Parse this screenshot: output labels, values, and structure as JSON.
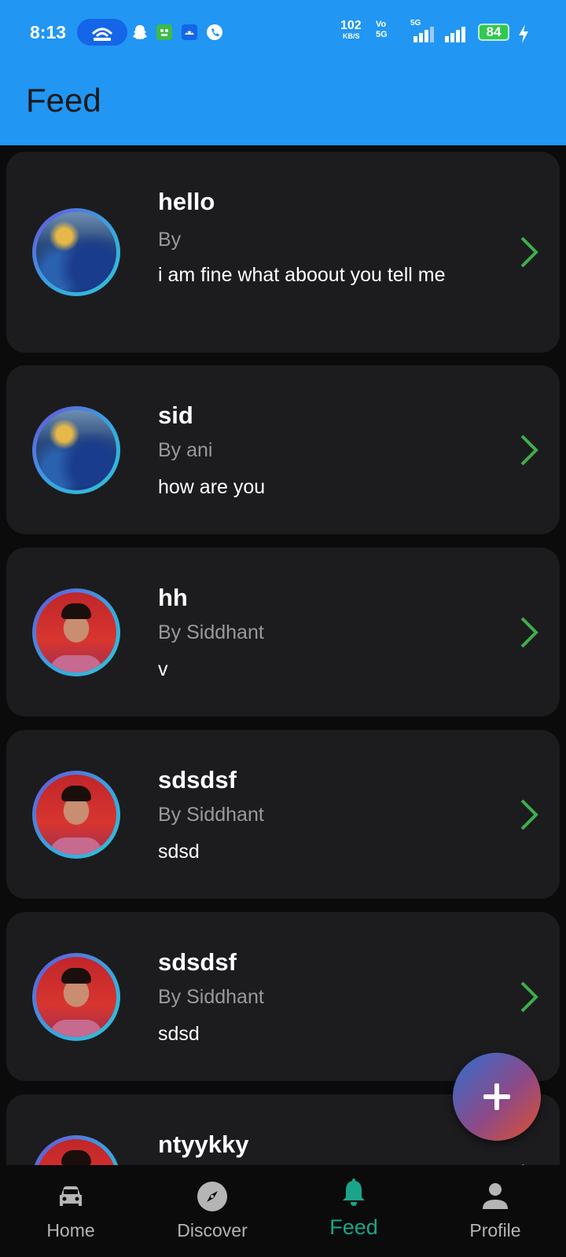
{
  "status_bar": {
    "time": "8:13",
    "net_speed_value": "102",
    "net_speed_unit": "KB/S",
    "volte_top": "Vo",
    "volte_bottom": "5G",
    "signal_label": "5G",
    "battery": "84"
  },
  "app_bar": {
    "title": "Feed",
    "color": "#2196f3"
  },
  "posts": [
    {
      "title": "hello",
      "author": "By",
      "body": "i am fine what aboout you tell me",
      "avatar": "globe-image"
    },
    {
      "title": "sid",
      "author": "By ani",
      "body": "how are you",
      "avatar": "globe-image"
    },
    {
      "title": "hh",
      "author": "By Siddhant",
      "body": "v",
      "avatar": "person-photo"
    },
    {
      "title": "sdsdsf",
      "author": "By Siddhant",
      "body": "sdsd",
      "avatar": "person-photo"
    },
    {
      "title": "sdsdsf",
      "author": "By Siddhant",
      "body": "sdsd",
      "avatar": "person-photo"
    },
    {
      "title": "ntyykky",
      "author": "",
      "body": "",
      "avatar": "person-photo"
    }
  ],
  "fab": {
    "icon": "plus-icon"
  },
  "bottom_nav": {
    "items": [
      {
        "label": "Home",
        "icon": "car-icon"
      },
      {
        "label": "Discover",
        "icon": "compass-icon"
      },
      {
        "label": "Feed",
        "icon": "bell-icon",
        "active": true
      },
      {
        "label": "Profile",
        "icon": "person-icon"
      }
    ],
    "active_color": "#1aa58a"
  }
}
